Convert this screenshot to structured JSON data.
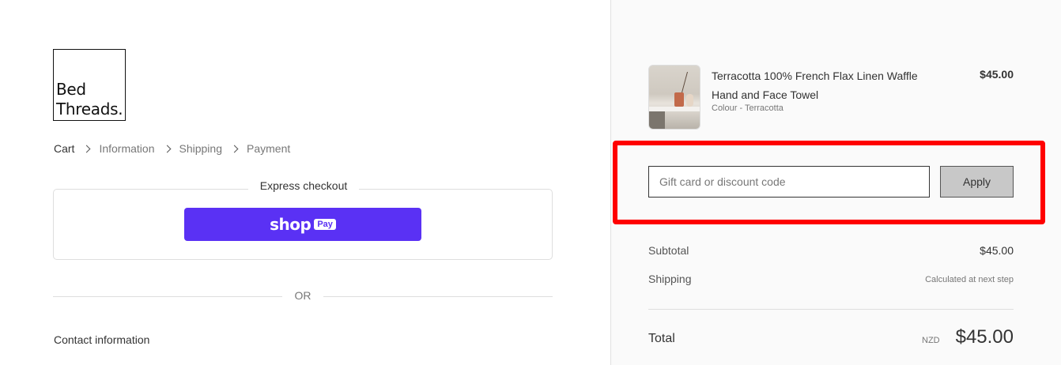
{
  "logo": {
    "line1": "Bed",
    "line2": "Threads."
  },
  "breadcrumb": [
    "Cart",
    "Information",
    "Shipping",
    "Payment"
  ],
  "express": {
    "title": "Express checkout",
    "shop_pay_word": "shop",
    "shop_pay_badge": "Pay",
    "shop_pay_color": "#5a31f4"
  },
  "or_text": "OR",
  "contact_heading": "Contact information",
  "product": {
    "name": "Terracotta 100% French Flax Linen Waffle Hand and Face Towel",
    "variant": "Colour - Terracotta",
    "price": "$45.00"
  },
  "discount": {
    "placeholder": "Gift card or discount code",
    "value": "",
    "apply_label": "Apply"
  },
  "summary": {
    "subtotal_label": "Subtotal",
    "subtotal_value": "$45.00",
    "shipping_label": "Shipping",
    "shipping_value": "Calculated at next step",
    "total_label": "Total",
    "currency": "NZD",
    "total_value": "$45.00"
  },
  "highlight_color": "#ff0000"
}
